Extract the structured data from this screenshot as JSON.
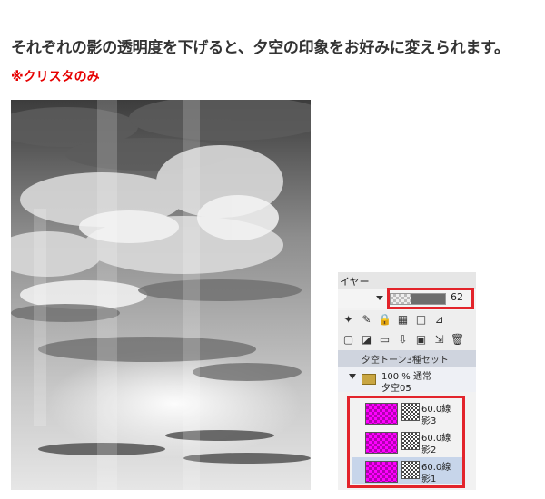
{
  "heading": "それぞれの影の透明度を下げると、夕空の印象をお好みに変えられます。",
  "note": "※クリスタのみ",
  "panel": {
    "title": "イヤー",
    "blend_mode": "",
    "opacity": {
      "value": "62",
      "fraction": 0.62
    },
    "folder_header": "夕空トーン3種セット",
    "folder": {
      "opacity": "100 %  通常",
      "name": "夕空05"
    },
    "layers": [
      {
        "lpi": "60.0線",
        "name": "影3",
        "selected": false
      },
      {
        "lpi": "60.0線",
        "name": "影2",
        "selected": false
      },
      {
        "lpi": "60.0線",
        "name": "影1",
        "selected": true
      }
    ],
    "accent_color": "#e3242b",
    "tone_color": "#ff00ff",
    "toolbar1_icons": [
      "sparkle-icon",
      "pencil-icon",
      "lock-icon",
      "lock-transparent-icon",
      "reference-icon",
      "ruler-icon"
    ],
    "toolbar2_icons": [
      "new-layer-icon",
      "new-vector-icon",
      "folder-icon",
      "transfer-icon",
      "mask-icon",
      "merge-icon",
      "trash-icon"
    ]
  }
}
